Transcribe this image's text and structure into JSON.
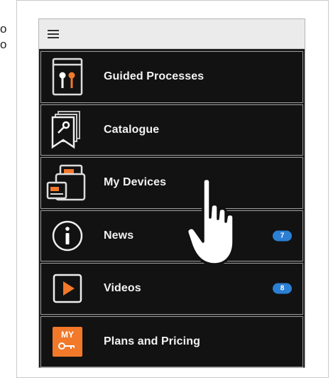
{
  "left_fragment": [
    "o",
    "o"
  ],
  "menu": {
    "items": [
      {
        "label": "Guided Processes",
        "icon": "guided-processes-icon",
        "badge": ""
      },
      {
        "label": "Catalogue",
        "icon": "catalogue-icon",
        "badge": ""
      },
      {
        "label": "My Devices",
        "icon": "devices-icon",
        "badge": ""
      },
      {
        "label": "News",
        "icon": "info-icon",
        "badge": "7"
      },
      {
        "label": "Videos",
        "icon": "play-icon",
        "badge": "8"
      },
      {
        "label": "Plans and Pricing",
        "icon": "my-key-icon",
        "badge": "",
        "tile_text": "MY"
      }
    ]
  },
  "colors": {
    "accent_orange": "#f2782a",
    "badge_blue": "#2b7fd4",
    "item_bg": "#121212"
  }
}
